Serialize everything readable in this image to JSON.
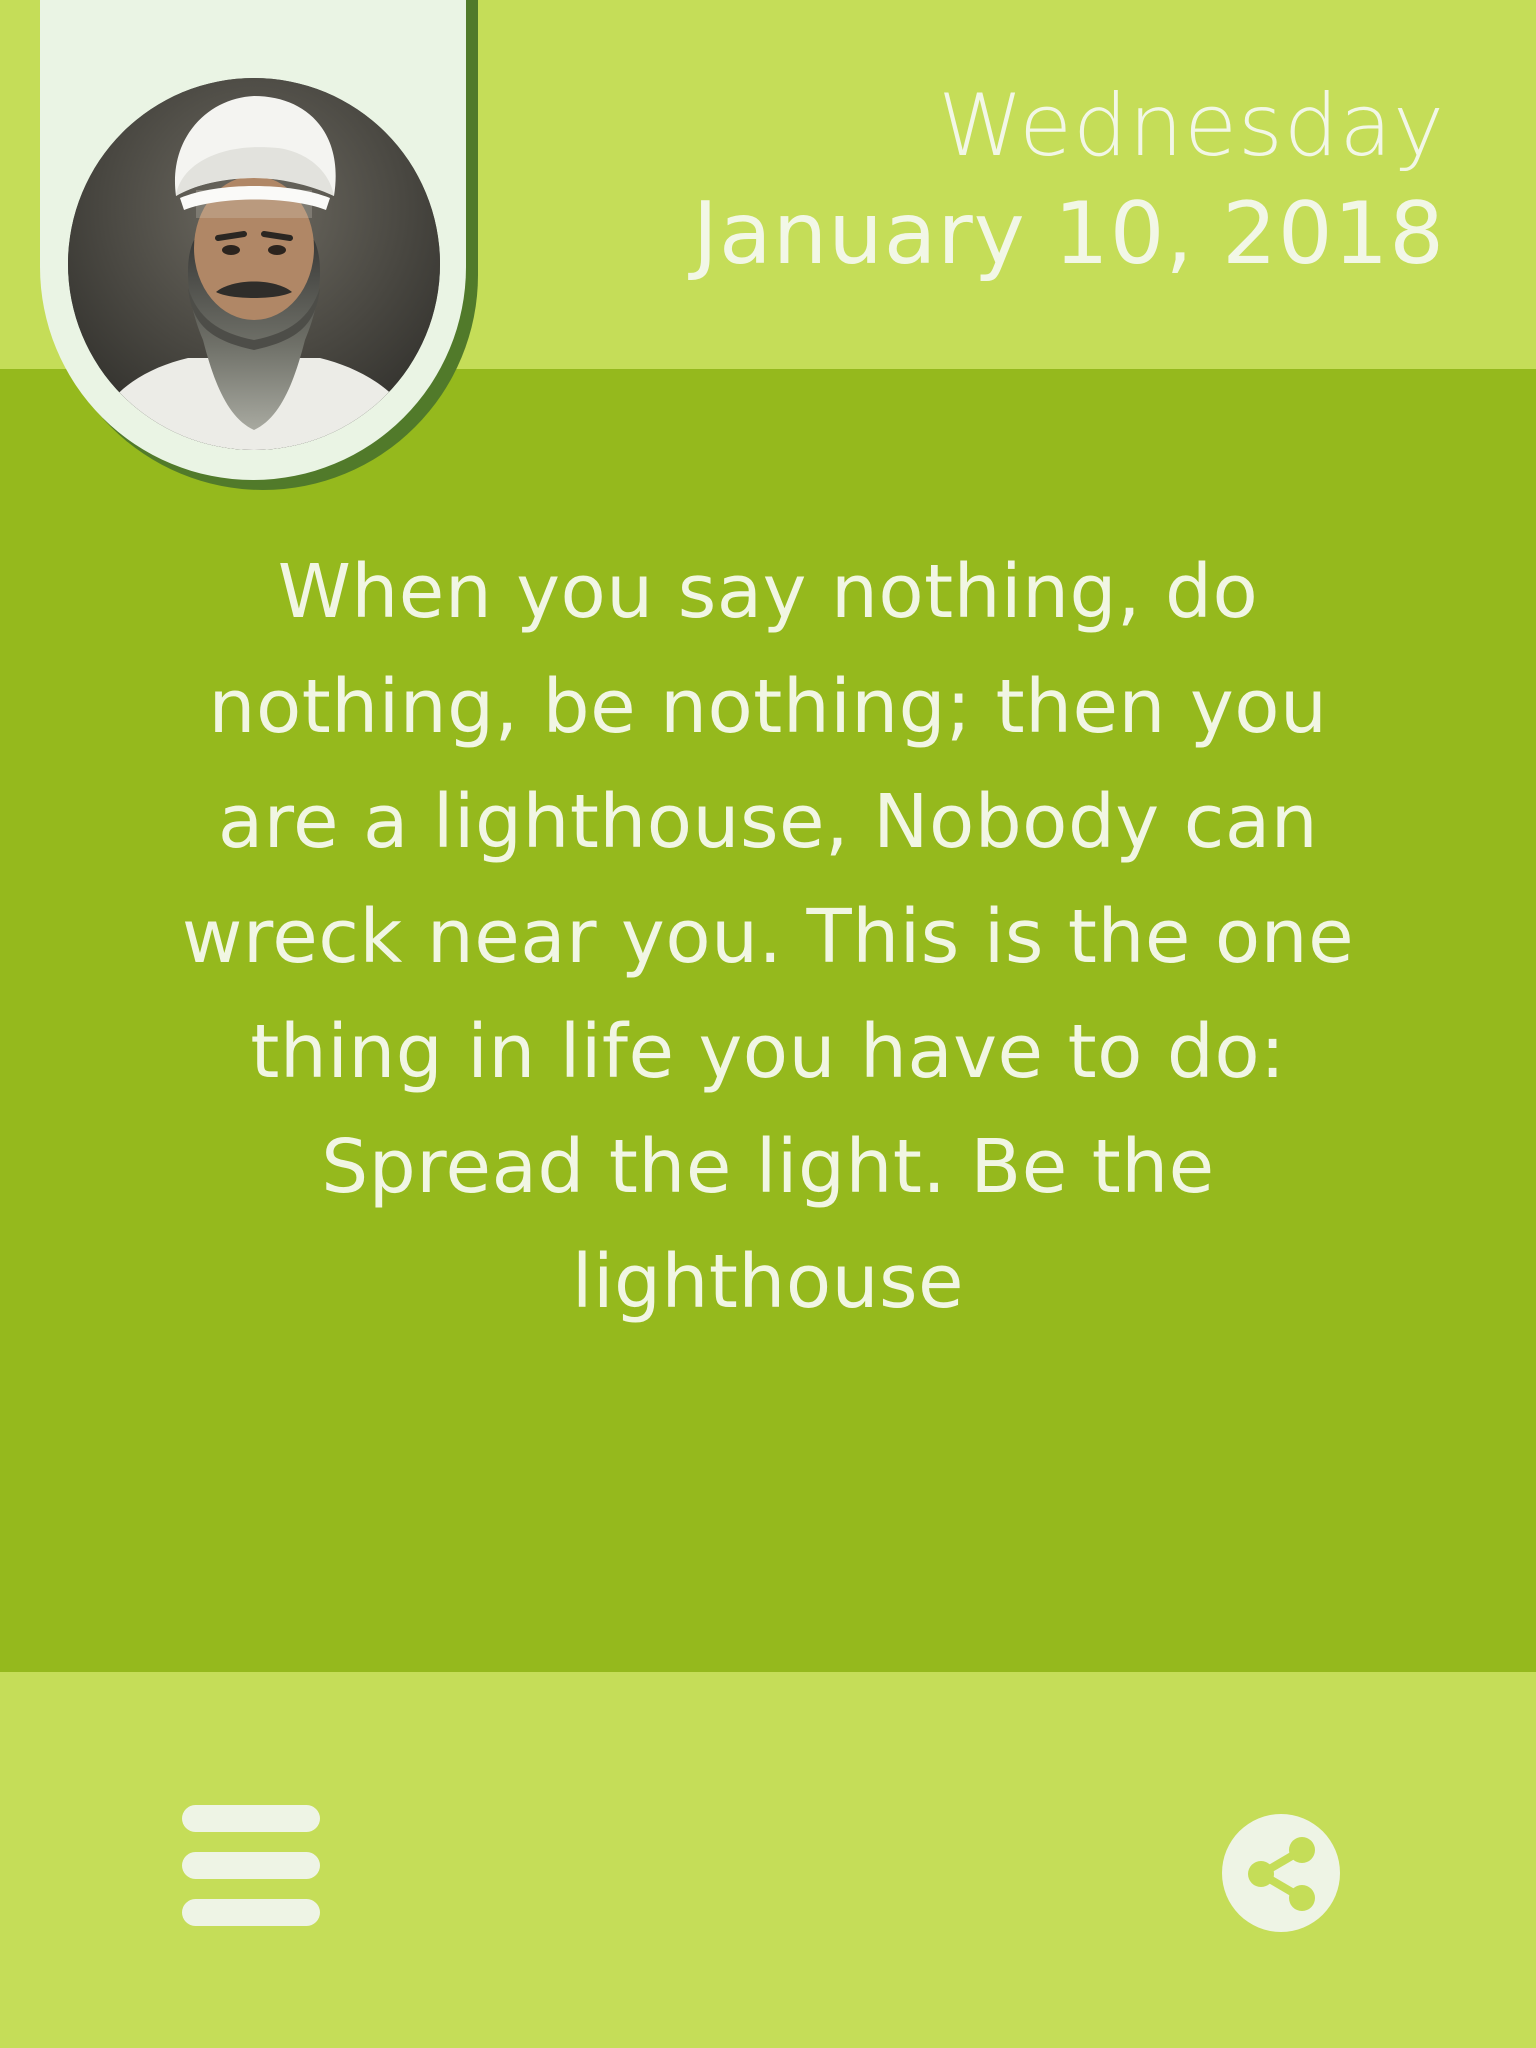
{
  "header": {
    "weekday": "Wednesday",
    "date": "January 10, 2018",
    "portrait_icon": "teacher-portrait"
  },
  "quote": {
    "text": "When you say nothing, do nothing, be nothing; then you are a lighthouse, Nobody can wreck near you. This is the one thing in life you have to do: Spread the light. Be the lighthouse"
  },
  "footer": {
    "menu_icon": "hamburger-menu-icon",
    "share_icon": "share-icon"
  },
  "colors": {
    "light_green": "#c5dd58",
    "dark_green": "#95b91d",
    "text": "#f1f6e3",
    "tab_background": "#eaf4e4",
    "tab_shadow": "#517a2a"
  }
}
